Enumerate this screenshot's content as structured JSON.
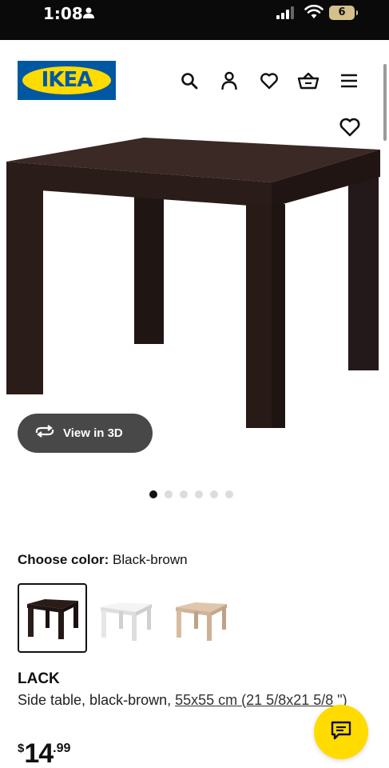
{
  "status_bar": {
    "time": "1:08",
    "battery": "6"
  },
  "header": {
    "logo_text": "IKEA",
    "icons": [
      "search-icon",
      "account-icon",
      "wishlist-icon",
      "cart-icon",
      "menu-icon"
    ]
  },
  "gallery": {
    "view_3d_label": "View in 3D",
    "image_count": 6,
    "active_index": 0
  },
  "color_picker": {
    "label": "Choose color:",
    "selected_value": "Black-brown",
    "swatches": [
      "black-brown",
      "white",
      "white stained oak effect"
    ]
  },
  "product": {
    "name": "LACK",
    "description": "Side table, black-brown,",
    "dimensions": "55x55 cm (21 5/8x21 5/8 \")",
    "price_currency": "$",
    "price_int": "14",
    "price_dec": ".99"
  },
  "colors": {
    "brand_blue": "#0058a3",
    "brand_yellow": "#ffdb00",
    "table_dark": "#2a1c18"
  }
}
